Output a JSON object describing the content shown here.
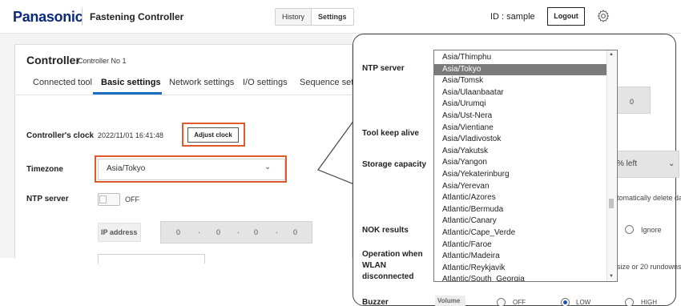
{
  "header": {
    "logo": "Panasonic",
    "app_title": "Fastening Controller",
    "tabs": [
      "History",
      "Settings"
    ],
    "user_id": "ID : sample",
    "logout_label": "Logout",
    "gear_icon": "gear-icon"
  },
  "controller": {
    "title": "Controller",
    "subtitle": "Controller No 1",
    "tabs": [
      "Connected tool",
      "Basic settings",
      "Network settings",
      "I/O settings",
      "Sequence setti"
    ],
    "active_tab": "Basic settings"
  },
  "basic": {
    "clock_label": "Controller's clock",
    "clock_value": "2022/11/01 16:41:48",
    "adjust_label": "Adjust clock",
    "timezone_label": "Timezone",
    "timezone_value": "Asia/Tokyo",
    "ntp_label": "NTP server",
    "ntp_state": "OFF",
    "ip_label": "IP address",
    "ip_octets": [
      "0",
      "0",
      "0",
      "0"
    ]
  },
  "zoom": {
    "ntp_label": "NTP server",
    "tool_keep_alive_label": "Tool keep alive",
    "storage_label": "Storage capacity",
    "storage_value": "% left",
    "auto_delete_text": "tomatically delete da",
    "nok_label": "NOK results",
    "ignore_label": "Ignore",
    "wlan_label": "Operation when WLAN disconnected",
    "wlan_text": "size or 20 rundowns",
    "buzzer_label": "Buzzer",
    "volume_label": "Volume",
    "buzzer_options": [
      "OFF",
      "LOW",
      "HIGH"
    ],
    "buzzer_selected": "LOW",
    "keep_alive_value": "0"
  },
  "timezone_list": {
    "options": [
      "Asia/Thimphu",
      "Asia/Tokyo",
      "Asia/Tomsk",
      "Asia/Ulaanbaatar",
      "Asia/Urumqi",
      "Asia/Ust-Nera",
      "Asia/Vientiane",
      "Asia/Vladivostok",
      "Asia/Yakutsk",
      "Asia/Yangon",
      "Asia/Yekaterinburg",
      "Asia/Yerevan",
      "Atlantic/Azores",
      "Atlantic/Bermuda",
      "Atlantic/Canary",
      "Atlantic/Cape_Verde",
      "Atlantic/Faroe",
      "Atlantic/Madeira",
      "Atlantic/Reykjavik",
      "Atlantic/South_Georgia"
    ],
    "selected": "Asia/Tokyo"
  },
  "colors": {
    "highlight": "#e05a2a",
    "brand": "#0b2a78",
    "tab_active": "#1a6dc0",
    "selected_option": "#7a7a7a"
  }
}
